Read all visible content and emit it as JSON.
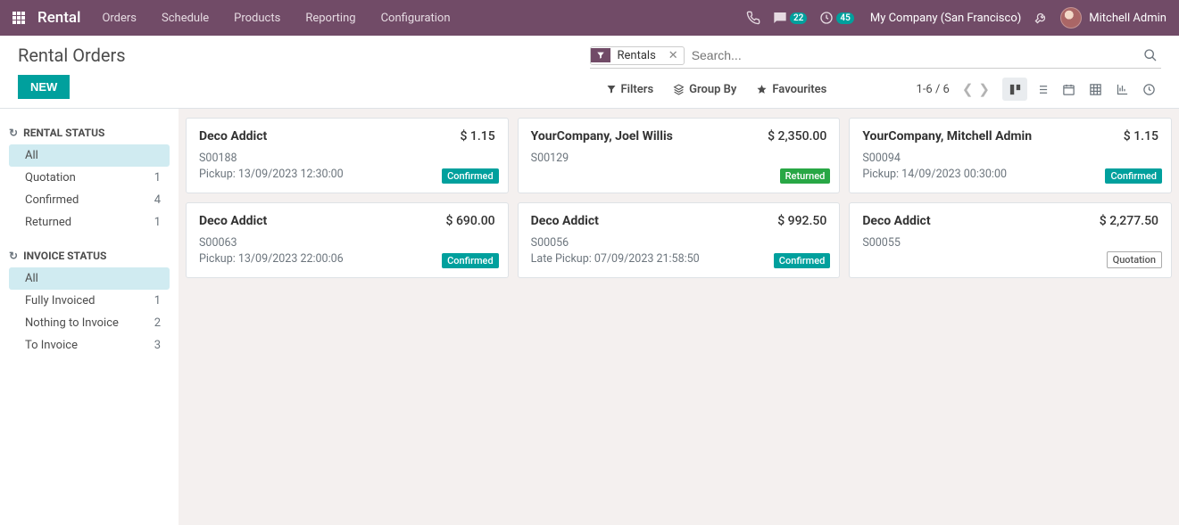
{
  "nav": {
    "brand": "Rental",
    "items": [
      "Orders",
      "Schedule",
      "Products",
      "Reporting",
      "Configuration"
    ],
    "msg_badge": "22",
    "clock_badge": "45",
    "company": "My Company (San Francisco)",
    "user": "Mitchell Admin"
  },
  "breadcrumb": "Rental Orders",
  "btn_new": "NEW",
  "facet": {
    "label": "Rentals"
  },
  "search": {
    "placeholder": "Search..."
  },
  "search_opts": {
    "filters": "Filters",
    "groupby": "Group By",
    "fav": "Favourites"
  },
  "pager": "1-6 / 6",
  "sidebar": {
    "rental_status": {
      "title": "RENTAL STATUS",
      "items": [
        {
          "label": "All",
          "count": "",
          "active": true
        },
        {
          "label": "Quotation",
          "count": "1"
        },
        {
          "label": "Confirmed",
          "count": "4"
        },
        {
          "label": "Returned",
          "count": "1"
        }
      ]
    },
    "invoice_status": {
      "title": "INVOICE STATUS",
      "items": [
        {
          "label": "All",
          "count": "",
          "active": true
        },
        {
          "label": "Fully Invoiced",
          "count": "1"
        },
        {
          "label": "Nothing to Invoice",
          "count": "2"
        },
        {
          "label": "To Invoice",
          "count": "3"
        }
      ]
    }
  },
  "cards": [
    {
      "title": "Deco Addict",
      "price": "$ 1.15",
      "line1": "S00188",
      "line2": "Pickup: 13/09/2023 12:30:00",
      "badge": "Confirmed",
      "badge_cls": "badge-confirmed"
    },
    {
      "title": "YourCompany, Joel Willis",
      "price": "$ 2,350.00",
      "line1": "S00129",
      "line2": "",
      "badge": "Returned",
      "badge_cls": "badge-returned"
    },
    {
      "title": "YourCompany, Mitchell Admin",
      "price": "$ 1.15",
      "line1": "S00094",
      "line2": "Pickup: 14/09/2023 00:30:00",
      "badge": "Confirmed",
      "badge_cls": "badge-confirmed"
    },
    {
      "title": "Deco Addict",
      "price": "$ 690.00",
      "line1": "S00063",
      "line2": "Pickup: 13/09/2023 22:00:06",
      "badge": "Confirmed",
      "badge_cls": "badge-confirmed"
    },
    {
      "title": "Deco Addict",
      "price": "$ 992.50",
      "line1": "S00056",
      "line2": "Late Pickup: 07/09/2023 21:58:50",
      "badge": "Confirmed",
      "badge_cls": "badge-confirmed"
    },
    {
      "title": "Deco Addict",
      "price": "$ 2,277.50",
      "line1": "S00055",
      "line2": "",
      "badge": "Quotation",
      "badge_cls": "badge-quotation"
    }
  ]
}
